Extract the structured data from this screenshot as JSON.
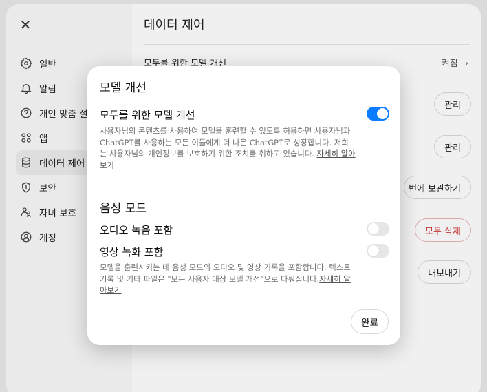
{
  "settings": {
    "close_symbol": "✕",
    "nav": [
      {
        "label": "일반",
        "icon": "gear-icon"
      },
      {
        "label": "알림",
        "icon": "bell-icon"
      },
      {
        "label": "개인 맞춤 설",
        "icon": "personalize-icon"
      },
      {
        "label": "앱",
        "icon": "apps-grid-icon"
      },
      {
        "label": "데이터 제어",
        "icon": "database-icon"
      },
      {
        "label": "보안",
        "icon": "shield-icon"
      },
      {
        "label": "자녀 보호",
        "icon": "parent-child-icon"
      },
      {
        "label": "계정",
        "icon": "account-icon"
      }
    ],
    "active_nav_index": 4,
    "main": {
      "title": "데이터 제어",
      "improve_model_label": "모두를 위한 모델 개선",
      "improve_model_value": "켜짐",
      "manage_label_1": "관리",
      "manage_label_2": "관리",
      "archive_label": "번에 보관하기",
      "delete_all_label": "모두 삭제",
      "export_label": "내보내기"
    }
  },
  "modal": {
    "title": "모델 개선",
    "improve": {
      "label": "모두를 위한 모델 개선",
      "enabled": true,
      "description": "사용자님의 콘텐츠를 사용하여 모델을 훈련할 수 있도록 허용하면 사용자님과 ChatGPT를 사용하는 모든 이들에게 더 나은 ChatGPT로 성장합니다. 저희는 사용자님의 개인정보를 보호하기 위한 조치를 취하고 있습니다. ",
      "learn_more": "자세히 알아보기"
    },
    "voice": {
      "heading": "음성 모드",
      "audio_label": "오디오 녹음 포함",
      "audio_enabled": false,
      "video_label": "영상 녹화 포함",
      "video_enabled": false,
      "description": "모델을 훈련시키는 데 음성 모드의 오디오 및 영상 기록을 포함합니다. 텍스트 기록 및 기타 파일은 \"모든 사용자 대상 모델 개선\"으로 다뤄집니다.",
      "learn_more": "자세히 알아보기"
    },
    "done_label": "완료"
  },
  "colors": {
    "toggle_on": "#0a7cff",
    "toggle_off": "#e6e6e6",
    "danger": "#d03a3a"
  }
}
